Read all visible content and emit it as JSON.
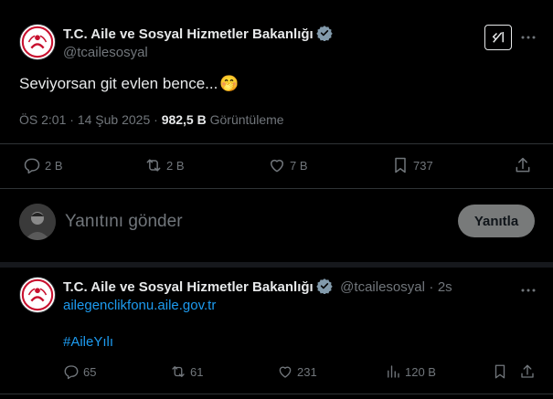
{
  "tweet": {
    "author_name": "T.C. Aile ve Sosyal Hizmetler Bakanlığı",
    "author_handle": "@tcailesosyal",
    "text": "Seviyorsan git evlen bence...",
    "emoji": "🤭",
    "time": "ÖS 2:01",
    "separator": "·",
    "date": "14 Şub 2025",
    "views": "982,5 B",
    "views_label": "Görüntüleme",
    "replies": "2 B",
    "retweets": "2 B",
    "likes": "7 B",
    "bookmarks": "737"
  },
  "composer": {
    "placeholder": "Yanıtını gönder",
    "reply_button": "Yanıtla"
  },
  "reply_tweet": {
    "author_name": "T.C. Aile ve Sosyal Hizmetler Bakanlığı",
    "author_handle": "@tcailesosyal",
    "separator": "·",
    "age": "2s",
    "link": "ailegenclikfonu.aile.gov.tr",
    "hashtag": "#AileYılı",
    "replies": "65",
    "retweets": "61",
    "likes": "231",
    "views": "120 B"
  },
  "colors": {
    "background": "#000000",
    "text": "#e7e9ea",
    "muted": "#71767b",
    "link": "#1d9bf0",
    "divider": "#2f3336",
    "verified": "#829aab"
  },
  "icons": {
    "grok": "grok-icon",
    "more": "more-icon",
    "reply": "reply-icon",
    "retweet": "retweet-icon",
    "like": "like-icon",
    "bookmark": "bookmark-icon",
    "share": "share-icon",
    "views": "views-icon",
    "verified": "verified-badge-icon"
  }
}
